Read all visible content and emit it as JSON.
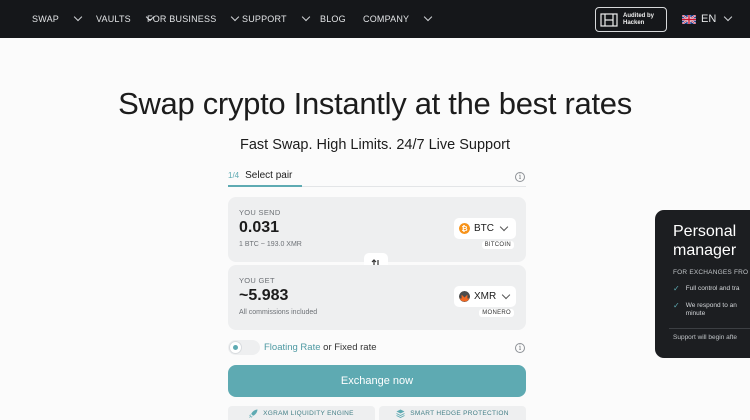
{
  "nav": {
    "items": [
      {
        "label": "SWAP"
      },
      {
        "label": "VAULTS"
      },
      {
        "label": "FOR BUSINESS"
      },
      {
        "label": "SUPPORT"
      },
      {
        "label": "BLOG"
      },
      {
        "label": "COMPANY"
      }
    ],
    "audit_text": "Audited by\nHacken",
    "language": "EN"
  },
  "hero": {
    "title": "Swap crypto Instantly at the best rates",
    "subtitle": "Fast Swap. High Limits. 24/7 Live Support"
  },
  "step": {
    "number": "1/4",
    "label": "Select pair"
  },
  "send": {
    "label": "YOU SEND",
    "amount": "0.031",
    "rate": "1 BTC ~ 193.0 XMR",
    "coin_symbol": "BTC",
    "coin_name": "BITCOIN",
    "coin_color": "#f7931a"
  },
  "get": {
    "label": "YOU GET",
    "amount": "~5.983",
    "note": "All commissions included",
    "coin_symbol": "XMR",
    "coin_name": "MONERO",
    "coin_color": "#f26822"
  },
  "rate_option": {
    "floating": "Floating Rate",
    "separator": " or ",
    "fixed": "Fixed rate"
  },
  "exchange_button": "Exchange now",
  "features": [
    "XGRAM LIQUIDITY ENGINE",
    "SMART HEDGE PROTECTION"
  ],
  "card": {
    "title": "Personal\nmanager",
    "subtitle": "FOR EXCHANGES FRO",
    "bullets": [
      "Full control and tra",
      "We respond to an\nminute"
    ],
    "footer": "Support will begin afte"
  },
  "colors": {
    "accent": "#5eaab2",
    "nav_bg": "#15171a"
  }
}
